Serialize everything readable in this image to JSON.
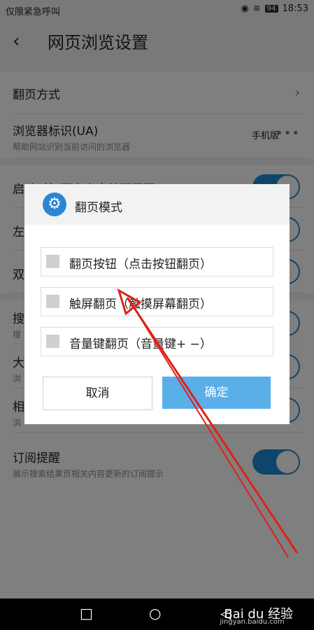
{
  "status_bar": {
    "left_text": "仅限紧急呼叫",
    "battery": "94",
    "time": "18:53"
  },
  "header": {
    "back_glyph": "‹",
    "title": "网页浏览设置"
  },
  "settings": {
    "page_turn_label": "翻页方式",
    "ua_label": "浏览器标识(UA)",
    "ua_sub": "帮助网站识别当前访问的浏览器",
    "ua_value": "手机版",
    "row3_label": "启动时打开上次未关闭网页",
    "row4_label": "左",
    "row5_label": "双",
    "row6_label": "搜",
    "row6_sub": "搜",
    "row7_label": "大",
    "row7_sub": "浏",
    "row8_label": "相",
    "row8_sub": "浏",
    "subscribe_label": "订阅提醒",
    "subscribe_sub": "展示搜索结果页相关内容更新的订阅提示"
  },
  "dialog": {
    "title": "翻页模式",
    "options": [
      "翻页按钮（点击按钮翻页）",
      "触屏翻页（触摸屏幕翻页）",
      "音量键翻页（音量键+ −）"
    ],
    "cancel_label": "取消",
    "ok_label": "确定"
  },
  "toggles": {
    "row3": "on",
    "row4": "on",
    "row5": "on",
    "row6": "on",
    "row7": "on",
    "row8": "on",
    "subscribe": "on"
  },
  "watermark": {
    "brand": "Bai du 经验",
    "url": "jingyan.baidu.com"
  },
  "colors": {
    "accent": "#1f8ad6",
    "ok_button": "#5aafe8",
    "annotation_arrow": "#e0201a"
  }
}
